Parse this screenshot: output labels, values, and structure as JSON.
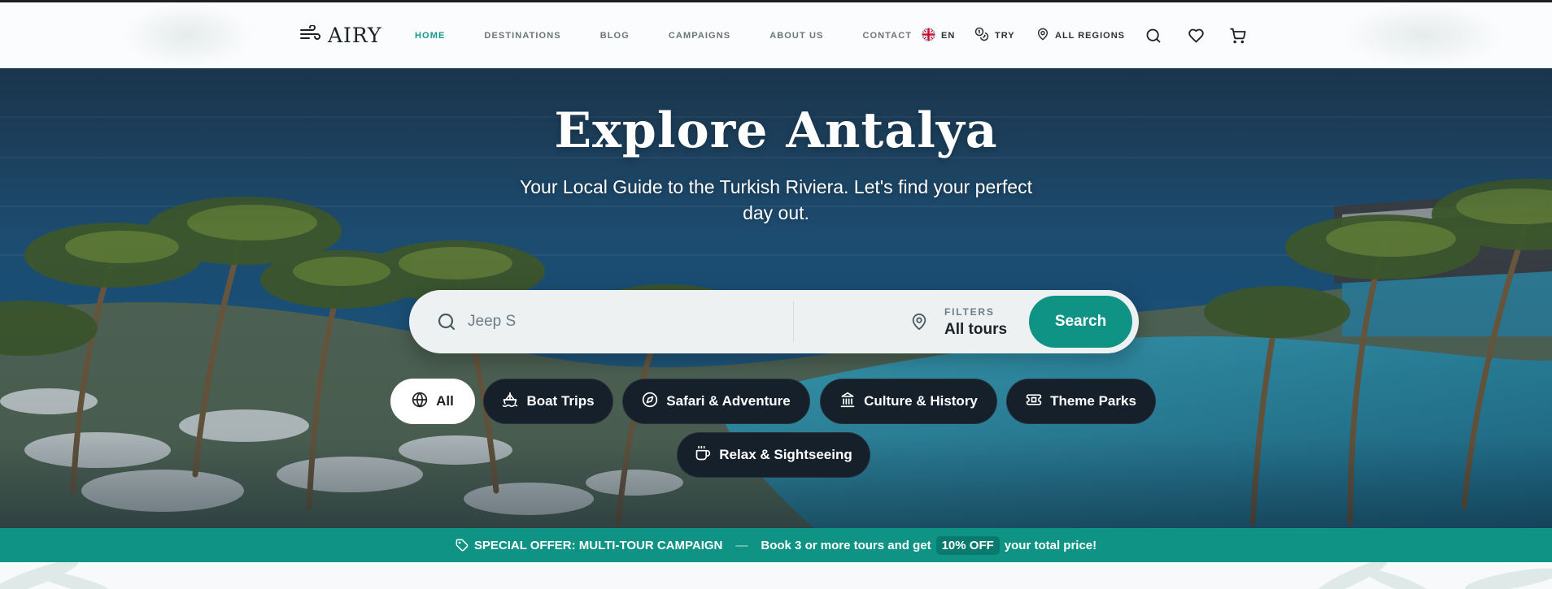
{
  "brand": {
    "name": "AIRY"
  },
  "nav": {
    "items": [
      {
        "label": "HOME",
        "active": true
      },
      {
        "label": "DESTINATIONS",
        "active": false
      },
      {
        "label": "BLOG",
        "active": false
      },
      {
        "label": "CAMPAIGNS",
        "active": false
      },
      {
        "label": "ABOUT US",
        "active": false
      },
      {
        "label": "CONTACT",
        "active": false
      }
    ],
    "language": "EN",
    "currency": "TRY",
    "region": "ALL REGIONS",
    "icons": [
      "search-icon",
      "heart-icon",
      "cart-icon"
    ]
  },
  "hero": {
    "title": "Explore Antalya",
    "subtitle": "Your Local Guide to the Turkish Riviera. Let's find your perfect day out."
  },
  "search": {
    "value": "Jeep S",
    "filters_label": "FILTERS",
    "filters_value": "All tours",
    "button_label": "Search"
  },
  "categories": [
    {
      "label": "All",
      "icon": "globe-icon",
      "active": true
    },
    {
      "label": "Boat Trips",
      "icon": "sailboat-icon",
      "active": false
    },
    {
      "label": "Safari & Adventure",
      "icon": "compass-icon",
      "active": false
    },
    {
      "label": "Culture & History",
      "icon": "landmark-icon",
      "active": false
    },
    {
      "label": "Theme Parks",
      "icon": "ticket-icon",
      "active": false
    },
    {
      "label": "Relax & Sightseeing",
      "icon": "coffee-icon",
      "active": false
    }
  ],
  "promo": {
    "title": "SPECIAL OFFER: MULTI-TOUR CAMPAIGN",
    "separator": "—",
    "text_before": "Book 3 or more tours and get",
    "highlight": "10% OFF",
    "text_after": "your total price!"
  },
  "colors": {
    "accent": "#0e9384",
    "nav_active": "#17998a",
    "chip_bg": "#15202b"
  }
}
